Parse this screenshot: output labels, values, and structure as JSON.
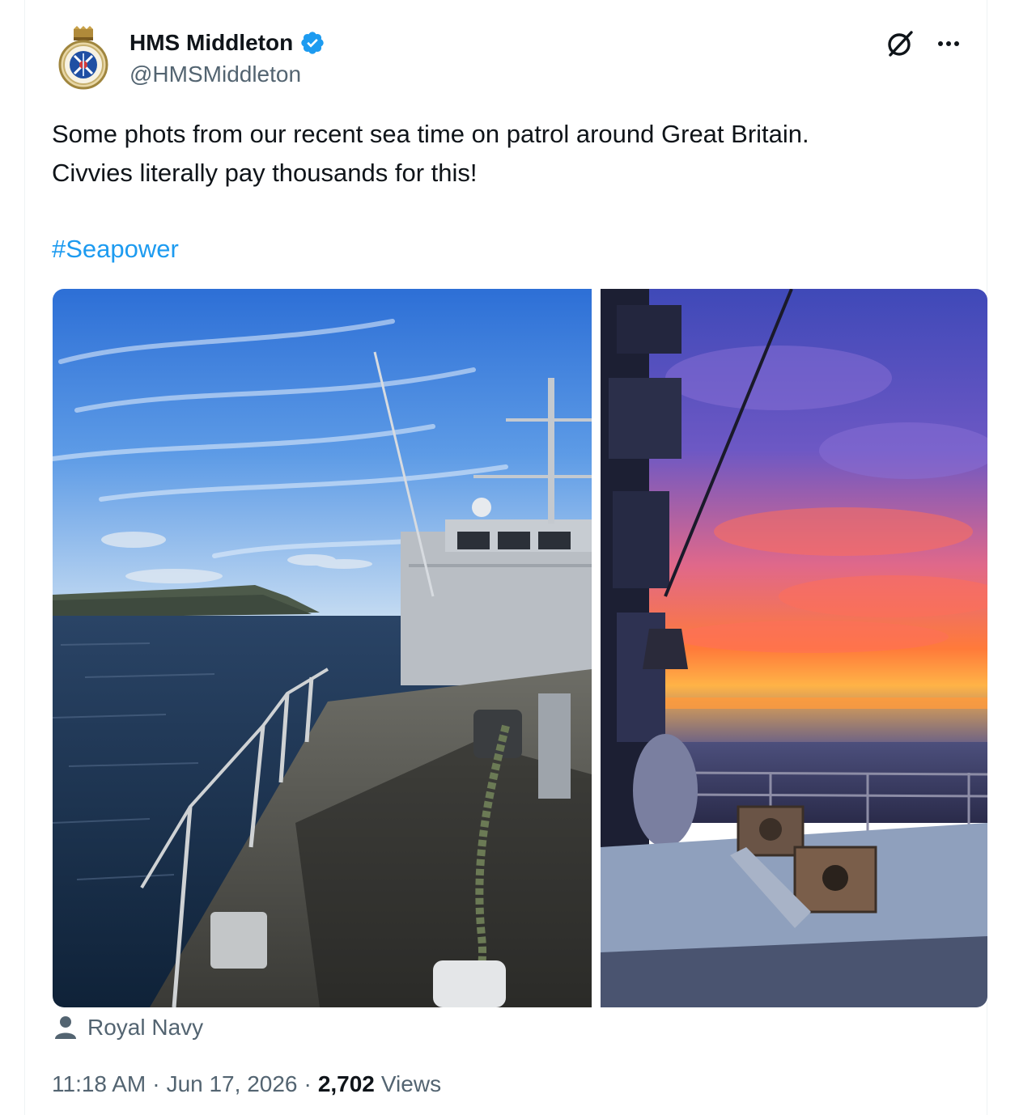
{
  "author": {
    "display_name": "HMS Middleton",
    "handle": "@HMSMiddleton",
    "verified": true,
    "avatar_icon": "ship-crest-icon"
  },
  "actions": {
    "grok_icon": "grok-icon",
    "more_icon": "more-horizontal-icon"
  },
  "tweet": {
    "text": "Some phots from our recent sea time on patrol around Great Britain.\nCivvies literally pay thousands for this!",
    "hashtag": "#Seapower"
  },
  "media": [
    {
      "subject": "warship-bow-daytime-photo"
    },
    {
      "subject": "ship-deck-sunset-photo"
    }
  ],
  "tagged_user": {
    "name": "Royal Navy",
    "icon": "person-icon"
  },
  "meta": {
    "time": "11:18 AM",
    "separator1": "·",
    "date": "Jun 17, 2026",
    "separator2": "·",
    "views_count": "2,702",
    "views_label": "Views"
  },
  "colors": {
    "accent": "#1d9bf0",
    "secondary_text": "#536471",
    "primary_text": "#0f1419"
  }
}
